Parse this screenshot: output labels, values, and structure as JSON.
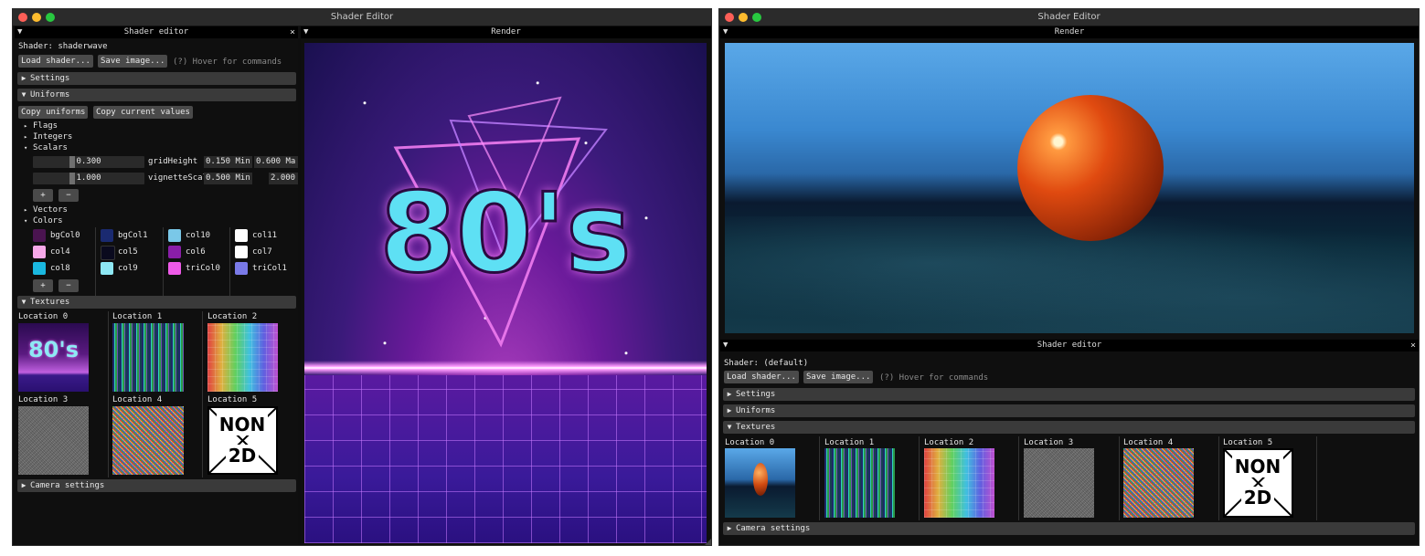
{
  "left": {
    "window_title": "Shader Editor",
    "editor": {
      "title": "Shader editor",
      "shader_label": "Shader: shaderwave",
      "load_button": "Load shader...",
      "save_button": "Save image...",
      "hint": "(?) Hover for commands",
      "settings": "Settings",
      "uniforms": "Uniforms",
      "copy_uniforms": "Copy uniforms",
      "copy_current": "Copy current values",
      "flags": "Flags",
      "integers": "Integers",
      "scalars": "Scalars",
      "scalar_rows": [
        {
          "value": "0.300",
          "name": "gridHeight",
          "min": "0.150",
          "min_label": "Min",
          "max": "0.600",
          "max_label": "Ma"
        },
        {
          "value": "1.000",
          "name": "vignetteScale",
          "min": "0.500",
          "min_label": "Min",
          "max": "2.000",
          "max_label": ""
        }
      ],
      "plus": "+",
      "minus": "−",
      "vectors": "Vectors",
      "colors": "Colors",
      "color_items": [
        {
          "name": "bgCol0",
          "color": "#4a1450"
        },
        {
          "name": "bgCol1",
          "color": "#1a2a70"
        },
        {
          "name": "col10",
          "color": "#7ac8e8"
        },
        {
          "name": "col11",
          "color": "#ffffff"
        },
        {
          "name": "col4",
          "color": "#f6a8e8"
        },
        {
          "name": "col5",
          "color": "#0a0a1e"
        },
        {
          "name": "col6",
          "color": "#8a1ea8"
        },
        {
          "name": "col7",
          "color": "#ffffff"
        },
        {
          "name": "col8",
          "color": "#1ab8e0"
        },
        {
          "name": "col9",
          "color": "#8ee8f4"
        },
        {
          "name": "triCol0",
          "color": "#ee5ae8"
        },
        {
          "name": "triCol1",
          "color": "#7a7ae8"
        }
      ],
      "textures": "Textures",
      "locations": [
        "Location 0",
        "Location 1",
        "Location 2",
        "Location 3",
        "Location 4",
        "Location 5"
      ],
      "non2d": {
        "top": "NON",
        "bottom": "2D"
      },
      "camera": "Camera settings"
    },
    "render": {
      "title": "Render",
      "art_text": "80's"
    }
  },
  "right": {
    "window_title": "Shader Editor",
    "render": {
      "title": "Render"
    },
    "editor": {
      "title": "Shader editor",
      "shader_label": "Shader: (default)",
      "load_button": "Load shader...",
      "save_button": "Save image...",
      "hint": "(?) Hover for commands",
      "settings": "Settings",
      "uniforms": "Uniforms",
      "textures": "Textures",
      "locations": [
        "Location 0",
        "Location 1",
        "Location 2",
        "Location 3",
        "Location 4",
        "Location 5"
      ],
      "non2d": {
        "top": "NON",
        "bottom": "2D"
      },
      "camera": "Camera settings"
    }
  },
  "colors": {
    "close_light": "#fe5f57",
    "minimize_light": "#febc2e",
    "zoom_light": "#28c840",
    "section_bg": "#3a3a3a",
    "button_bg": "#4a4a4a"
  },
  "icons": {
    "collapse": "▼",
    "expand": "▶",
    "tree_open": "▾",
    "tree_closed": "▸",
    "close": "×"
  }
}
